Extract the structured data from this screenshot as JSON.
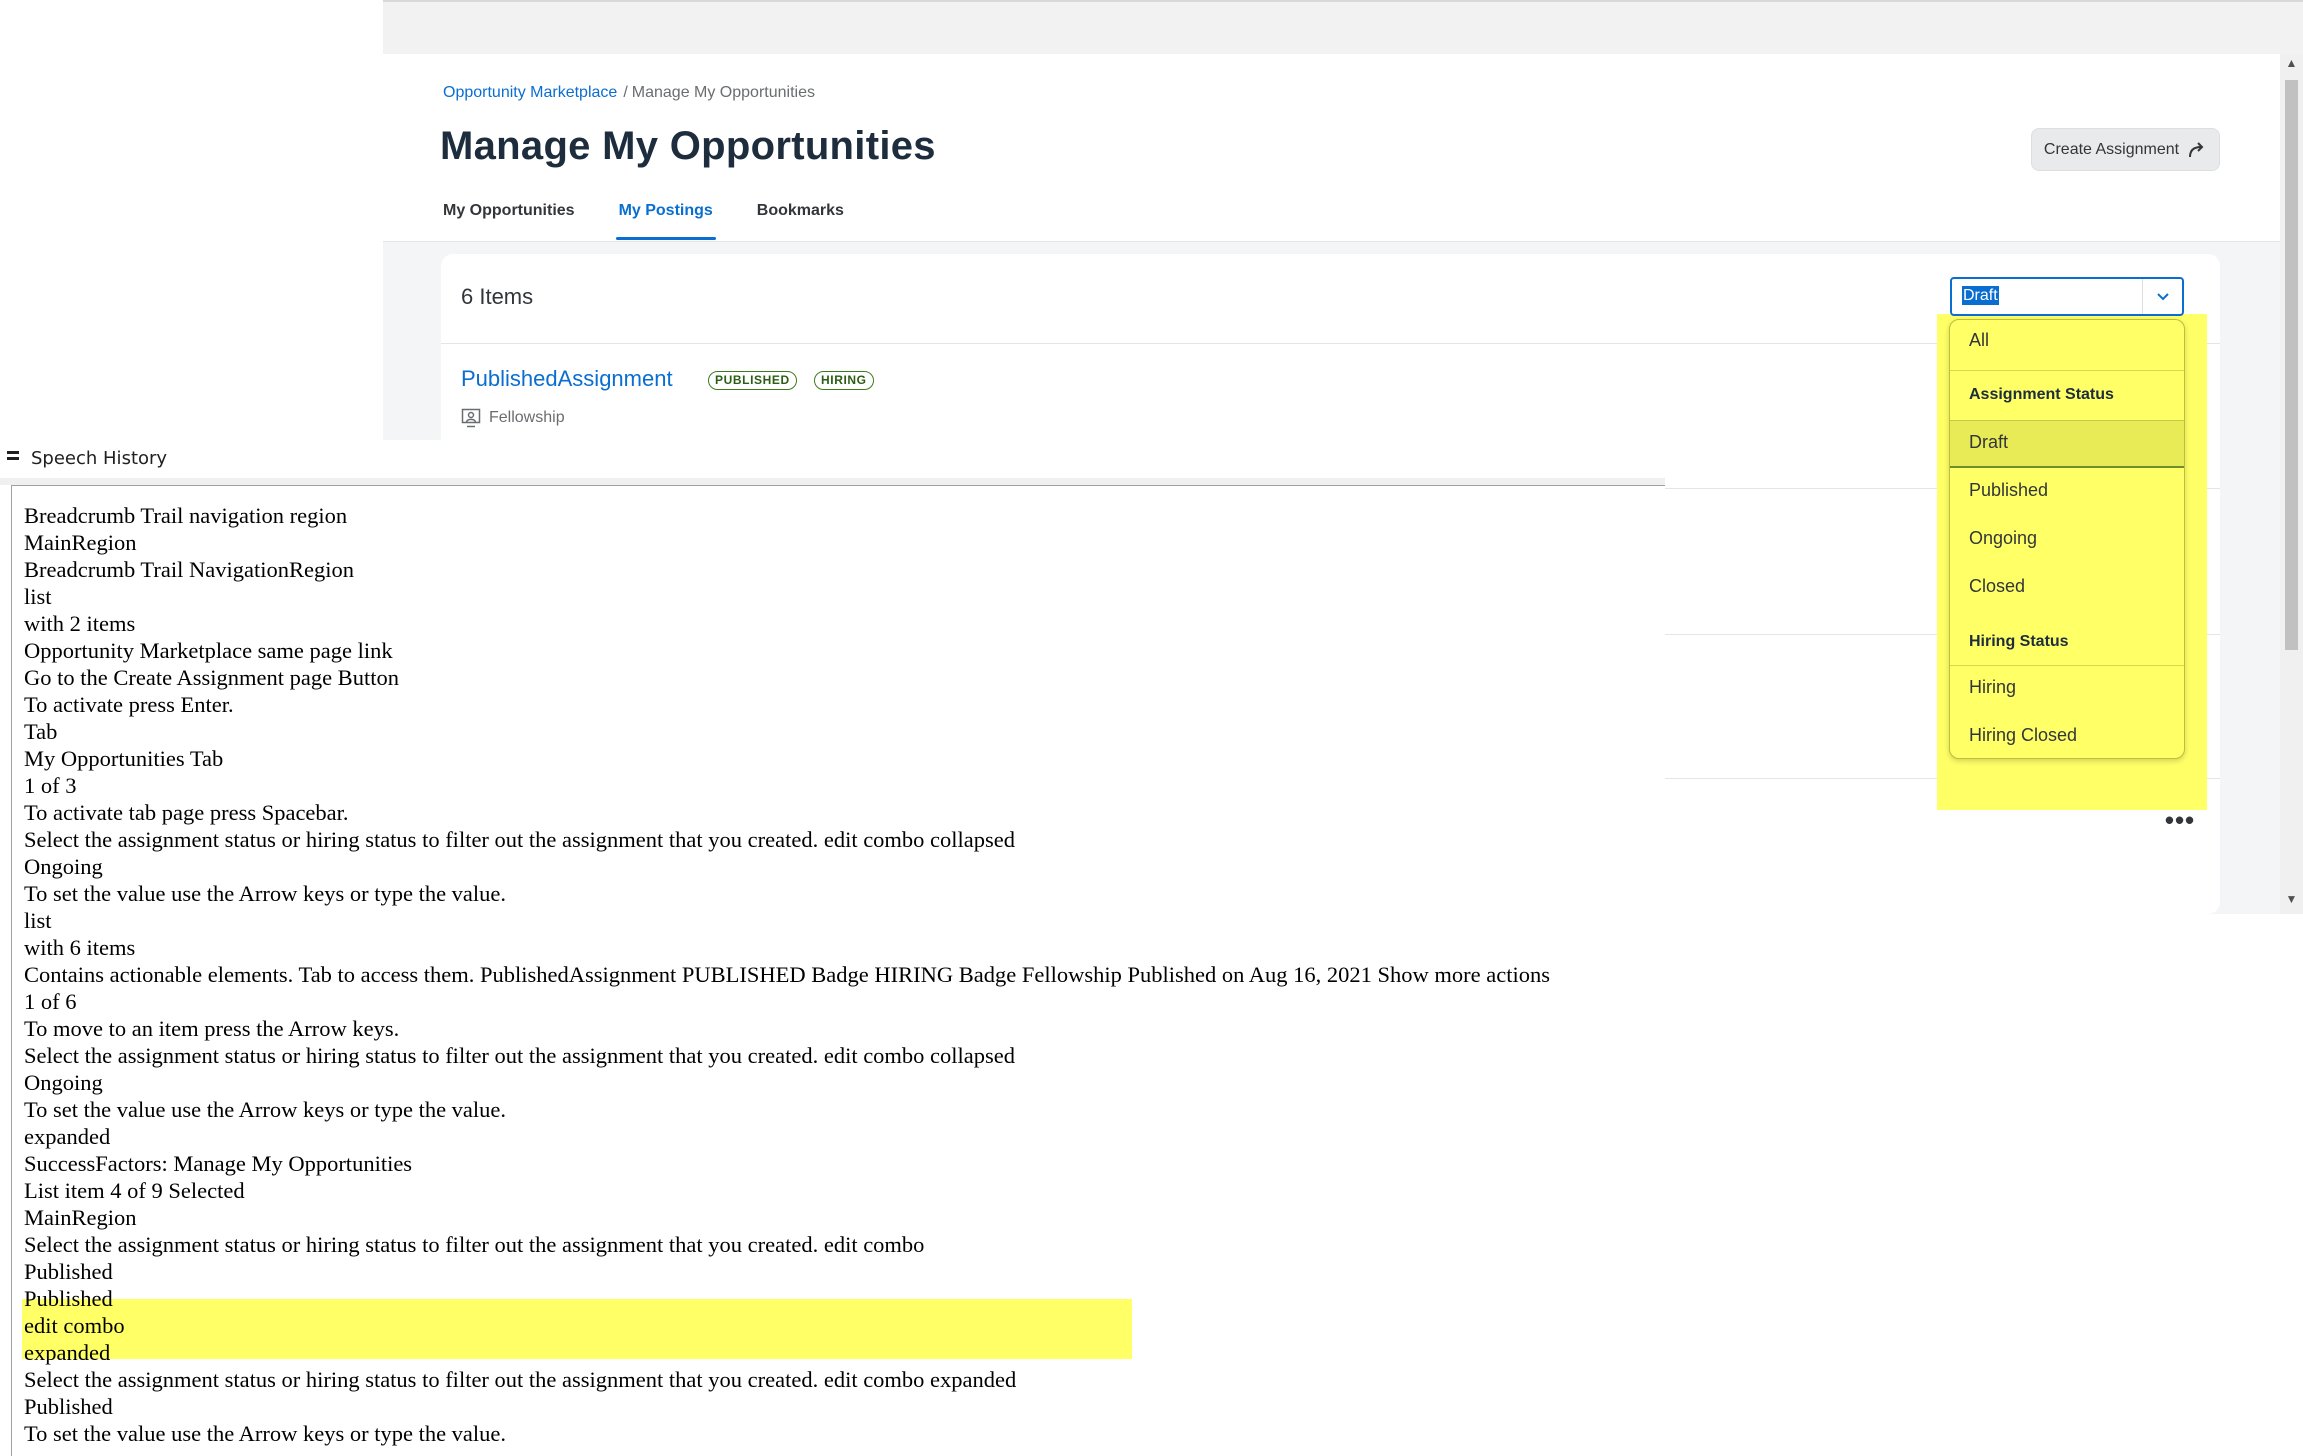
{
  "breadcrumb": {
    "link": "Opportunity Marketplace",
    "separator": "/",
    "current": "Manage My Opportunities"
  },
  "page_title": "Manage My Opportunities",
  "create_button": {
    "label": "Create Assignment",
    "icon": "share-arrow-icon"
  },
  "tabs": [
    {
      "label": "My Opportunities",
      "active": false
    },
    {
      "label": "My Postings",
      "active": true
    },
    {
      "label": "Bookmarks",
      "active": false
    }
  ],
  "list": {
    "count_label": "6 Items",
    "items": [
      {
        "title": "PublishedAssignment",
        "badges": [
          "PUBLISHED",
          "HIRING"
        ],
        "type": "Fellowship",
        "type_icon": "person-board-icon"
      }
    ],
    "more_actions": "•••"
  },
  "combo": {
    "value": "Draft",
    "arrow_icon": "chevron-down-icon",
    "options": {
      "all": "All",
      "group_assignment": "Assignment Status",
      "draft": "Draft",
      "published": "Published",
      "ongoing": "Ongoing",
      "closed": "Closed",
      "group_hiring": "Hiring Status",
      "hiring": "Hiring",
      "hiring_closed": "Hiring Closed"
    },
    "selected_option": "Draft"
  },
  "speech_history": {
    "title": "Speech History",
    "lines": [
      "Breadcrumb Trail navigation region",
      "MainRegion",
      "Breadcrumb Trail NavigationRegion",
      "list",
      "with 2 items",
      "Opportunity Marketplace same page link",
      "Go to the Create Assignment page Button",
      "To activate press Enter.",
      "Tab",
      "My Opportunities Tab",
      "1 of 3",
      "To activate tab page press Spacebar.",
      "Select the assignment status or hiring status to filter out the assignment that you created. edit combo collapsed",
      "Ongoing",
      "To set the value use the Arrow keys or type the value.",
      "list",
      "with 6 items",
      "Contains actionable elements. Tab to access them. PublishedAssignment PUBLISHED Badge HIRING Badge Fellowship Published on Aug 16, 2021 Show more actions",
      "1 of 6",
      "To move to an item press the Arrow keys.",
      "Select the assignment status or hiring status to filter out the assignment that you created. edit combo collapsed",
      "Ongoing",
      "To set the value use the Arrow keys or type the value.",
      "expanded",
      "SuccessFactors: Manage My Opportunities",
      "List item 4 of 9 Selected",
      "MainRegion",
      "Select the assignment status or hiring status to filter out the assignment that you created. edit combo",
      "Published",
      "Published",
      "edit combo",
      "expanded",
      "Select the assignment status or hiring status to filter out the assignment that you created. edit combo expanded",
      "Published",
      "To set the value use the Arrow keys or type the value."
    ]
  }
}
